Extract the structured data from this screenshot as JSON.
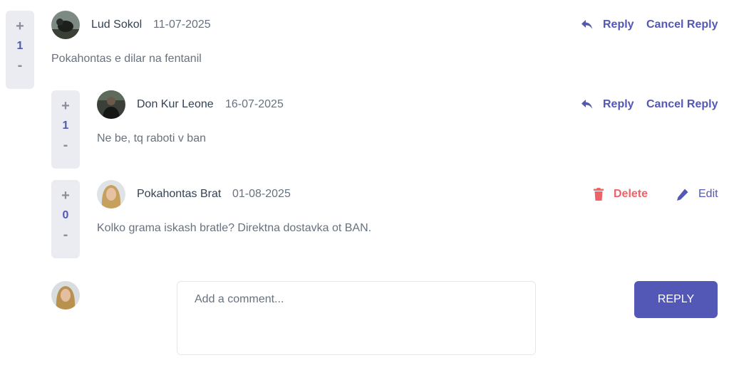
{
  "comments": [
    {
      "vote": {
        "plus": "+",
        "score": "1",
        "minus": "-"
      },
      "author": "Lud Sokol",
      "date": "11-07-2025",
      "text": "Pokahontas e dilar na fentanil",
      "actions": {
        "reply": "Reply",
        "cancel": "Cancel Reply"
      },
      "avatar_icon": "user-avatar-icon"
    },
    {
      "vote": {
        "plus": "+",
        "score": "1",
        "minus": "-"
      },
      "author": "Don Kur Leone",
      "date": "16-07-2025",
      "text": "Ne be, tq raboti v ban",
      "actions": {
        "reply": "Reply",
        "cancel": "Cancel Reply"
      },
      "avatar_icon": "user-avatar-icon"
    },
    {
      "vote": {
        "plus": "+",
        "score": "0",
        "minus": "-"
      },
      "author": "Pokahontas Brat",
      "date": "01-08-2025",
      "text": "Kolko grama iskash bratle? Direktna dostavka ot BAN.",
      "actions": {
        "delete": "Delete",
        "edit": "Edit"
      },
      "avatar_icon": "user-avatar-icon"
    }
  ],
  "composer": {
    "placeholder": "Add a comment...",
    "button": "REPLY"
  },
  "colors": {
    "primary": "#5357b6",
    "danger": "#ed6368",
    "vote_bg": "#eaecf1",
    "text": "#67727e",
    "name": "#334253"
  }
}
